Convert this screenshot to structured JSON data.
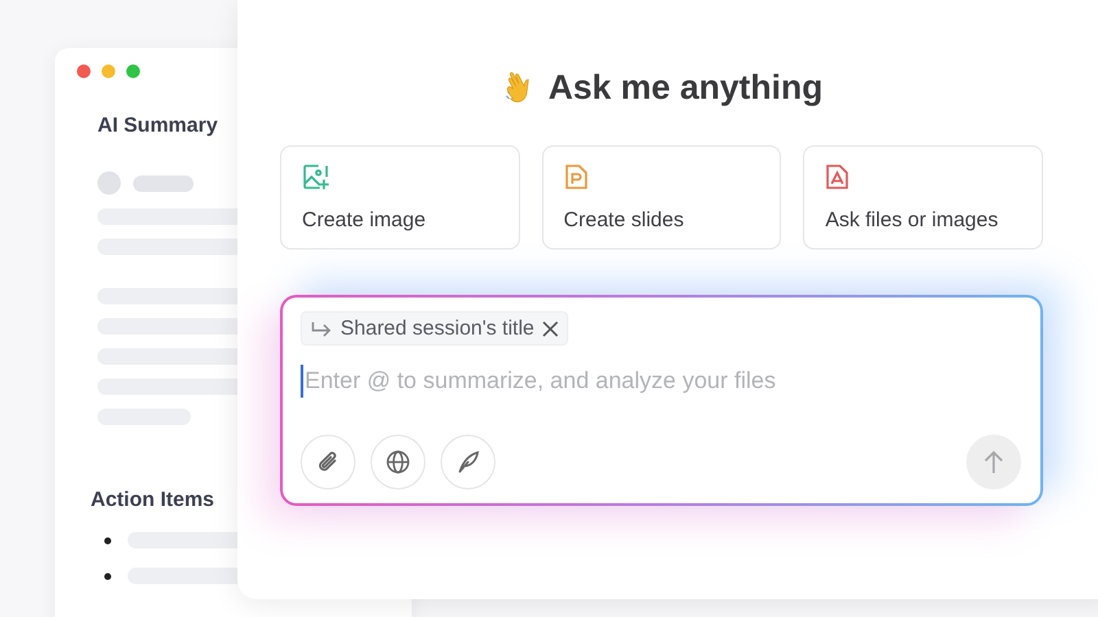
{
  "back_window": {
    "heading": "AI Summary",
    "section_heading": "Action Items"
  },
  "main": {
    "title": "Ask me anything",
    "actions": [
      {
        "kind": "image",
        "label": "Create image"
      },
      {
        "kind": "slides",
        "label": "Create slides"
      },
      {
        "kind": "files",
        "label": "Ask files or images"
      }
    ],
    "composer": {
      "chip": "Shared session's title",
      "placeholder": "Enter @ to summarize, and analyze your files",
      "tools": [
        {
          "kind": "attach"
        },
        {
          "kind": "web"
        },
        {
          "kind": "write"
        }
      ],
      "send_disabled": true
    }
  }
}
